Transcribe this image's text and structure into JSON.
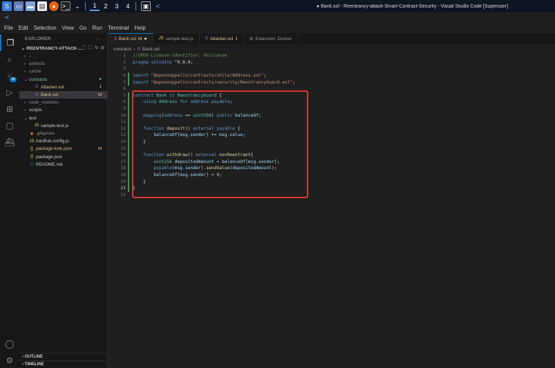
{
  "taskbar": {
    "workspaces": [
      "1",
      "2",
      "3",
      "4"
    ],
    "window_title": "● Bank.sol - Reentrancy-attack-Smart-Contract-Security - Visual Studio Code [Superuser]"
  },
  "menu": [
    "File",
    "Edit",
    "Selection",
    "View",
    "Go",
    "Run",
    "Terminal",
    "Help"
  ],
  "activity_bar": {
    "scm_badge": "46"
  },
  "sidebar": {
    "header": "EXPLORER",
    "section": "REENTRANCY-ATTACK-...",
    "items": [
      {
        "label": "-",
        "indent": 1,
        "chevron": "›",
        "icon": "",
        "status": "",
        "style": "normal"
      },
      {
        "label": "artifacts",
        "indent": 1,
        "chevron": "›",
        "icon": "",
        "status": "",
        "style": "dim"
      },
      {
        "label": "cache",
        "indent": 1,
        "chevron": "›",
        "icon": "",
        "status": "",
        "style": "dim"
      },
      {
        "label": "contracts",
        "indent": 1,
        "chevron": "⌄",
        "icon": "",
        "status": "●",
        "style": "green"
      },
      {
        "label": "Attacker.sol",
        "indent": 2,
        "chevron": "",
        "icon": "S",
        "status": "1",
        "style": "mod"
      },
      {
        "label": "Bank.sol",
        "indent": 2,
        "chevron": "",
        "icon": "S",
        "status": "M",
        "style": "selected"
      },
      {
        "label": "node_modules",
        "indent": 1,
        "chevron": "›",
        "icon": "",
        "status": "",
        "style": "dim"
      },
      {
        "label": "scripts",
        "indent": 1,
        "chevron": "›",
        "icon": "",
        "status": "",
        "style": "normal"
      },
      {
        "label": "test",
        "indent": 1,
        "chevron": "⌄",
        "icon": "",
        "status": "",
        "style": "normal"
      },
      {
        "label": "sample-test.js",
        "indent": 2,
        "chevron": "",
        "icon": "JS",
        "status": "",
        "style": "normal"
      },
      {
        "label": ".gitignore",
        "indent": 1,
        "chevron": "",
        "icon": "◆",
        "status": "",
        "style": "dim"
      },
      {
        "label": "hardhat.config.js",
        "indent": 1,
        "chevron": "",
        "icon": "JS",
        "status": "",
        "style": "normal"
      },
      {
        "label": "package-lock.json",
        "indent": 1,
        "chevron": "",
        "icon": "{}",
        "status": "M",
        "style": "mod"
      },
      {
        "label": "package.json",
        "indent": 1,
        "chevron": "",
        "icon": "{}",
        "status": "",
        "style": "normal"
      },
      {
        "label": "README.md",
        "indent": 1,
        "chevron": "",
        "icon": "ⓘ",
        "status": "",
        "style": "normal"
      }
    ],
    "outline": "OUTLINE",
    "timeline": "TIMELINE"
  },
  "tabs": [
    {
      "lang": "S",
      "label": "Bank.sol",
      "suffix": "M",
      "dirty": "●",
      "active": true,
      "italic": false
    },
    {
      "lang": "JS",
      "label": "sample-test.js",
      "suffix": "",
      "dirty": "",
      "active": false,
      "italic": true
    },
    {
      "lang": "S",
      "label": "Attacker.sol",
      "suffix": "1",
      "dirty": "",
      "active": false,
      "italic": false
    },
    {
      "lang": "",
      "label": "Extension: Docker",
      "suffix": "",
      "dirty": "",
      "active": false,
      "italic": false
    }
  ],
  "breadcrumb": [
    "contracts",
    "›",
    "S",
    "Bank.sol"
  ],
  "code_lines": [
    [
      [
        "//SPDX-License-Identifier: Unlicense",
        "com"
      ]
    ],
    [
      [
        "pragma solidity ",
        "kw"
      ],
      [
        "^0.8.0",
        "plain"
      ],
      [
        ";",
        "plain"
      ]
    ],
    [],
    [
      [
        "import ",
        "kw"
      ],
      [
        "\"@openzeppelin/contracts/utils/Address.sol\"",
        "str"
      ],
      [
        ";",
        "plain"
      ]
    ],
    [
      [
        "import ",
        "kw"
      ],
      [
        "\"@openzeppelin/contracts/security/ReentrancyGuard.sol\"",
        "str"
      ],
      [
        ";",
        "plain"
      ]
    ],
    [],
    [
      [
        "contract ",
        "kw"
      ],
      [
        "Bank ",
        "type"
      ],
      [
        "is ",
        "kw"
      ],
      [
        "ReentrancyGuard ",
        "type"
      ],
      [
        "{",
        "plain"
      ]
    ],
    [
      [
        "    using ",
        "kw"
      ],
      [
        "Address ",
        "type"
      ],
      [
        "for ",
        "kw"
      ],
      [
        "address payable",
        "kw"
      ],
      [
        ";",
        "plain"
      ]
    ],
    [],
    [
      [
        "    mapping",
        "kw"
      ],
      [
        "(",
        "plain"
      ],
      [
        "address ",
        "kw"
      ],
      [
        "=> ",
        "plain"
      ],
      [
        "uint256",
        "type"
      ],
      [
        ") ",
        "plain"
      ],
      [
        "public ",
        "kw"
      ],
      [
        "balanceOf",
        "var"
      ],
      [
        ";",
        "plain"
      ]
    ],
    [],
    [
      [
        "    function ",
        "kw"
      ],
      [
        "deposit",
        "fn"
      ],
      [
        "() ",
        "plain"
      ],
      [
        "external payable ",
        "kw"
      ],
      [
        "{",
        "plain"
      ]
    ],
    [
      [
        "        balanceOf",
        "var"
      ],
      [
        "[",
        "plain"
      ],
      [
        "msg",
        "var"
      ],
      [
        ".sender",
        "var"
      ],
      [
        "] += ",
        "plain"
      ],
      [
        "msg",
        "var"
      ],
      [
        ".value",
        "var"
      ],
      [
        ";",
        "plain"
      ]
    ],
    [
      [
        "    }",
        "plain"
      ]
    ],
    [],
    [
      [
        "    function ",
        "kw"
      ],
      [
        "withdraw",
        "fn"
      ],
      [
        "() ",
        "plain"
      ],
      [
        "external ",
        "kw"
      ],
      [
        "nonReentrant",
        "fn"
      ],
      [
        "{",
        "plain"
      ]
    ],
    [
      [
        "        uint256 ",
        "type"
      ],
      [
        "depositedAmount ",
        "var"
      ],
      [
        "= ",
        "plain"
      ],
      [
        "balanceOf",
        "var"
      ],
      [
        "[",
        "plain"
      ],
      [
        "msg.sender",
        "var"
      ],
      [
        "];",
        "plain"
      ]
    ],
    [
      [
        "        payable",
        "kw"
      ],
      [
        "(",
        "plain"
      ],
      [
        "msg.sender",
        "var"
      ],
      [
        ").",
        "plain"
      ],
      [
        "sendValue",
        "fn"
      ],
      [
        "(",
        "plain"
      ],
      [
        "depositedAmount",
        "var"
      ],
      [
        ");",
        "plain"
      ]
    ],
    [
      [
        "        balanceOf",
        "var"
      ],
      [
        "[",
        "plain"
      ],
      [
        "msg.sender",
        "var"
      ],
      [
        "] = ",
        "plain"
      ],
      [
        "0",
        "plain"
      ],
      [
        ";",
        "plain"
      ]
    ],
    [
      [
        "    }",
        "plain"
      ]
    ],
    [
      [
        "}",
        "plain"
      ]
    ],
    []
  ],
  "current_line": 21,
  "colors": {
    "accent": "#0078d4",
    "highlight_box": "#d9372f",
    "modified": "#e2c08d"
  }
}
